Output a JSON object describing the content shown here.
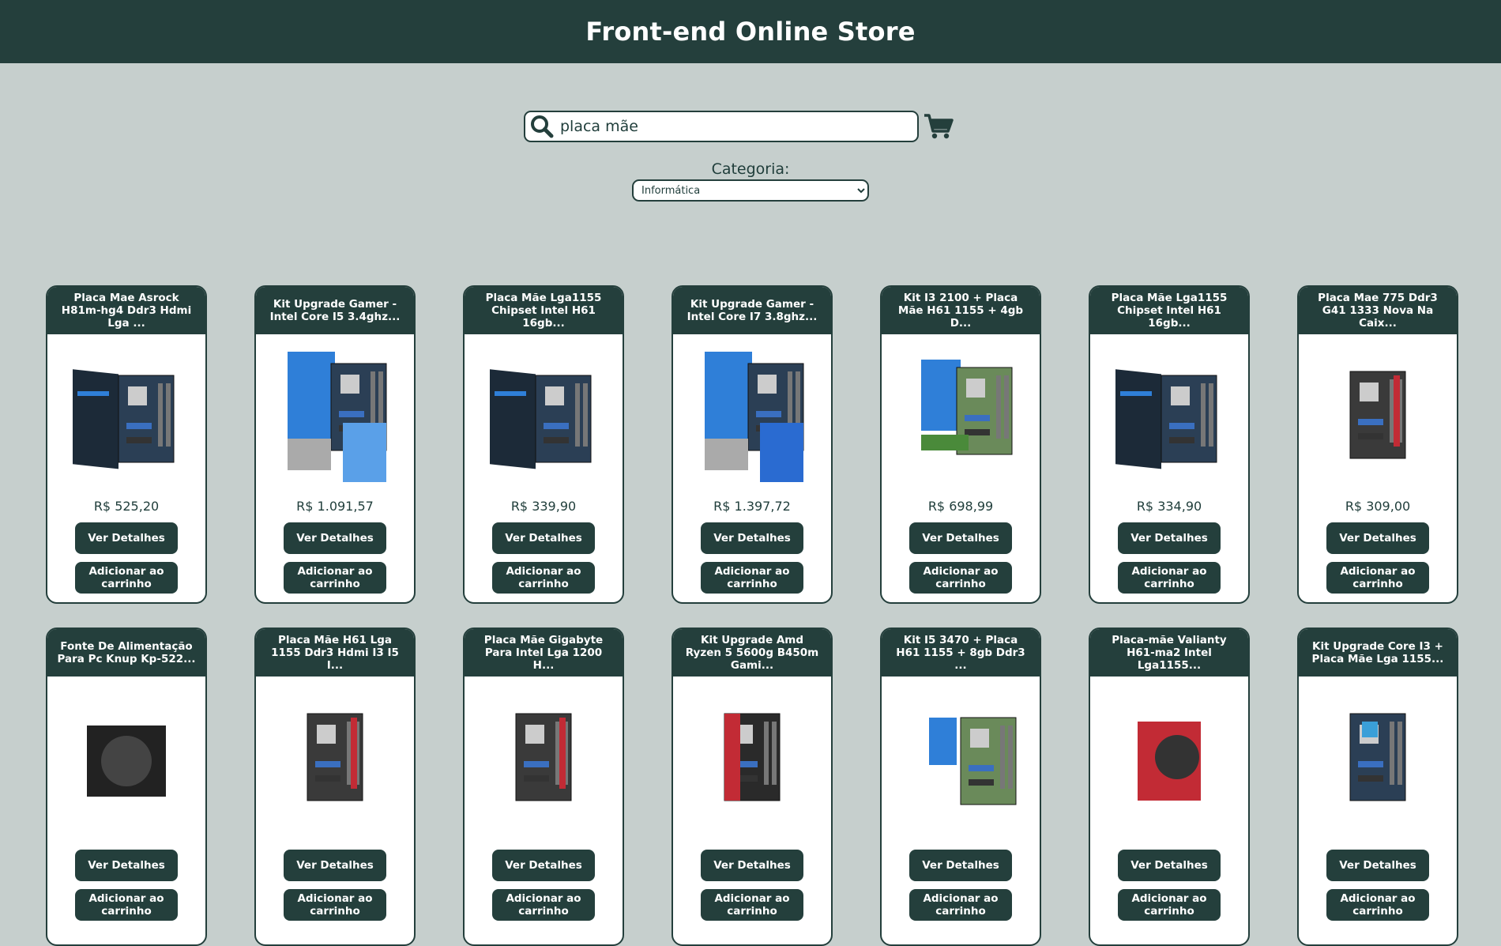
{
  "header": {
    "title": "Front-end Online Store"
  },
  "search": {
    "value": "placa mãe",
    "icon": "search-icon"
  },
  "cart": {
    "icon": "cart-icon"
  },
  "category": {
    "label": "Categoria:",
    "selected": "Informática"
  },
  "buttons": {
    "details": "Ver Detalhes",
    "add": "Adicionar ao carrinho"
  },
  "products": [
    {
      "title": "Placa Mae Asrock H81m-hg4 Ddr3 Hdmi Lga ...",
      "price": "R$ 525,20",
      "image": "motherboard-box"
    },
    {
      "title": "Kit Upgrade Gamer - Intel Core I5 3.4ghz...",
      "price": "R$ 1.091,57",
      "image": "upgrade-kit-i5"
    },
    {
      "title": "Placa Mãe Lga1155 Chipset Intel H61 16gb...",
      "price": "R$ 339,90",
      "image": "motherboard-box"
    },
    {
      "title": "Kit Upgrade Gamer - Intel Core I7 3.8ghz...",
      "price": "R$ 1.397,72",
      "image": "upgrade-kit-i7"
    },
    {
      "title": "Kit I3 2100 + Placa Mãe H61 1155 + 4gb D...",
      "price": "R$ 698,99",
      "image": "kit-i3"
    },
    {
      "title": "Placa Mãe Lga1155 Chipset Intel H61 16gb...",
      "price": "R$ 334,90",
      "image": "motherboard-box"
    },
    {
      "title": "Placa Mae 775 Ddr3 G41 1333 Nova Na Caix...",
      "price": "R$ 309,00",
      "image": "motherboard"
    },
    {
      "title": "Fonte De Alimentação Para Pc Knup Kp-522...",
      "price": "",
      "image": "power-supply"
    },
    {
      "title": "Placa Mãe H61 Lga 1155 Ddr3 Hdmi I3 I5 I...",
      "price": "",
      "image": "motherboard"
    },
    {
      "title": "Placa Mãe Gigabyte Para Intel Lga 1200 H...",
      "price": "",
      "image": "motherboard"
    },
    {
      "title": "Kit Upgrade Amd Ryzen 5 5600g B450m Gami...",
      "price": "",
      "image": "motherboard-red"
    },
    {
      "title": "Kit I5 3470 + Placa H61 1155 + 8gb Ddr3 ...",
      "price": "",
      "image": "kit-i5"
    },
    {
      "title": "Placa-mãe Valianty H61-ma2 Intel Lga1155...",
      "price": "",
      "image": "box-red"
    },
    {
      "title": "Kit Upgrade Core I3 + Placa Mãe Lga 1155...",
      "price": "",
      "image": "motherboard-blue"
    }
  ]
}
